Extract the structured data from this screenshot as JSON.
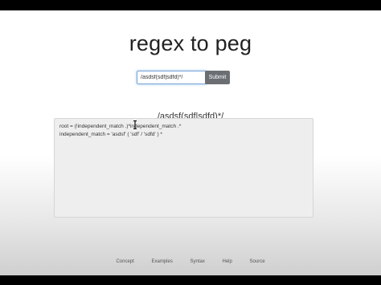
{
  "page": {
    "title": "regex to peg"
  },
  "form": {
    "input_value": "/asdsf(sdf|sdfd)*/",
    "submit_label": "Submit"
  },
  "result": {
    "regex": "/asdsf(sdf|sdfd)*/",
    "lines": [
      "root = (!independent_match .)*independent_match .*",
      "independent_match = 'asdsf' ( 'sdf' / 'sdfd' ) *"
    ]
  },
  "footer": {
    "links": [
      "Concept",
      "Examples",
      "Syntax",
      "Help",
      "Source"
    ]
  }
}
